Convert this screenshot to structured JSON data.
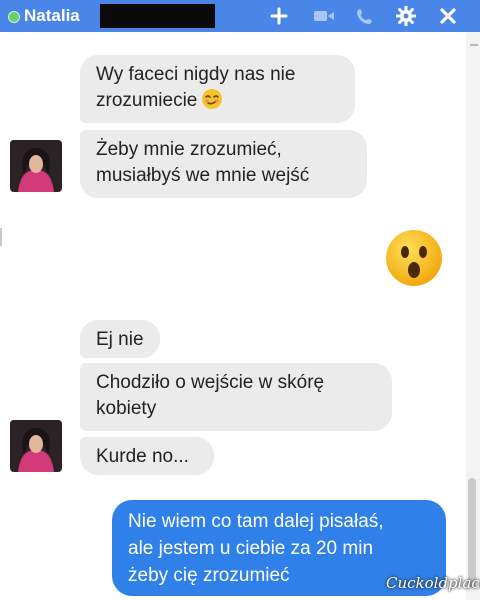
{
  "header": {
    "contact_name": "Natalia",
    "status": "online",
    "accent_color": "#4a86e8",
    "icons": [
      "add-icon",
      "video-call-icon",
      "phone-icon",
      "gear-icon",
      "close-icon"
    ]
  },
  "messages": [
    {
      "from": "contact",
      "lines": [
        "Wy faceci nigdy nas nie",
        "zrozumiecie"
      ],
      "emoji": "smirk-emoji"
    },
    {
      "from": "contact",
      "lines": [
        "Żeby mnie zrozumieć,",
        "musiałbyś we mnie wejść"
      ]
    },
    {
      "from": "me",
      "emoji": "surprised-face-emoji"
    },
    {
      "from": "contact",
      "lines": [
        "Ej nie"
      ]
    },
    {
      "from": "contact",
      "lines": [
        "Chodziło o wejście w skórę",
        "kobiety"
      ]
    },
    {
      "from": "contact",
      "lines": [
        "Kurde no..."
      ]
    },
    {
      "from": "me",
      "lines": [
        "Nie wiem co tam dalej pisałaś,",
        "ale jestem u ciebie za 20 min",
        "żeby cię zrozumieć"
      ]
    }
  ],
  "watermark": "Cuckoldplace",
  "colors": {
    "received_bubble": "#ebebeb",
    "sent_bubble": "#2f80e8"
  }
}
